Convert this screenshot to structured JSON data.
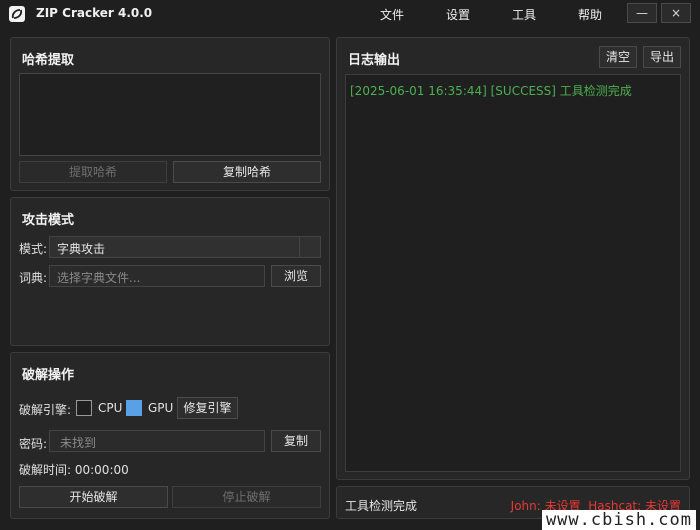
{
  "app": {
    "title": "ZIP Cracker 4.0.0"
  },
  "menu": [
    {
      "label": "文件"
    },
    {
      "label": "设置"
    },
    {
      "label": "工具"
    },
    {
      "label": "帮助"
    }
  ],
  "window": {
    "minimize": "—",
    "close": "×"
  },
  "hash_panel": {
    "title": "哈希提取",
    "hash_value": "",
    "extract_btn": "提取哈希",
    "copy_btn": "复制哈希"
  },
  "attack_panel": {
    "title": "攻击模式",
    "mode_label": "模式:",
    "mode_value": "字典攻击",
    "dict_label": "词典:",
    "dict_placeholder": "选择字典文件...",
    "browse_btn": "浏览"
  },
  "crack_panel": {
    "title": "破解操作",
    "engine_label": "破解引擎:",
    "cpu_label": "CPU",
    "cpu_checked": false,
    "gpu_label": "GPU",
    "gpu_checked": true,
    "repair_btn": "修复引擎",
    "password_label": "密码:",
    "password_value": "未找到",
    "copy_btn": "复制",
    "time_label": "破解时间: 00:00:00",
    "start_btn": "开始破解",
    "stop_btn": "停止破解"
  },
  "log_panel": {
    "title": "日志输出",
    "clear_btn": "清空",
    "export_btn": "导出",
    "lines": [
      "[2025-06-01 16:35:44] [SUCCESS] 工具检测完成"
    ]
  },
  "status": {
    "left": "工具检测完成",
    "right": "John: 未设置  Hashcat: 未设置"
  },
  "watermark": "www.cbish.com",
  "colors": {
    "success": "#4caf50",
    "error": "#e53935",
    "accent": "#5aa0e6"
  }
}
